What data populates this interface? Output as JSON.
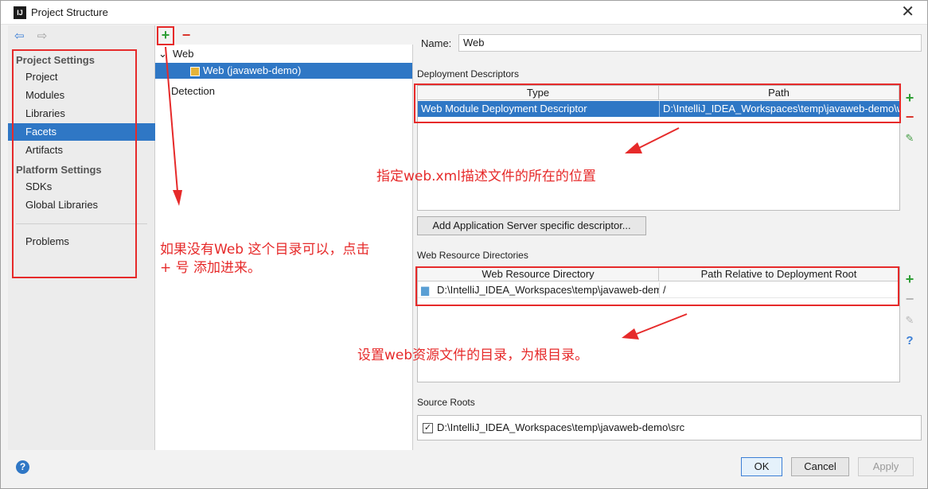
{
  "window": {
    "title": "Project Structure",
    "icon_label": "IJ"
  },
  "sidebar": {
    "project_settings_header": "Project Settings",
    "platform_settings_header": "Platform Settings",
    "items": [
      {
        "label": "Project"
      },
      {
        "label": "Modules"
      },
      {
        "label": "Libraries"
      },
      {
        "label": "Facets"
      },
      {
        "label": "Artifacts"
      },
      {
        "label": "SDKs"
      },
      {
        "label": "Global Libraries"
      },
      {
        "label": "Problems"
      }
    ],
    "selected": "Facets"
  },
  "tree": {
    "add_symbol": "+",
    "remove_symbol": "−",
    "root": "Web",
    "child": "Web (javaweb-demo)",
    "detection": "Detection"
  },
  "facet": {
    "name_label": "Name:",
    "name_value": "Web",
    "deployment_descriptors_title": "Deployment Descriptors",
    "dd_columns": [
      "Type",
      "Path"
    ],
    "dd_row": {
      "type": "Web Module Deployment Descriptor",
      "path": "D:\\IntelliJ_IDEA_Workspaces\\temp\\javaweb-demo\\w"
    },
    "add_descriptor_button": "Add Application Server specific descriptor...",
    "web_resource_title": "Web Resource Directories",
    "wr_columns": [
      "Web Resource Directory",
      "Path Relative to Deployment Root"
    ],
    "wr_row": {
      "dir": "D:\\IntelliJ_IDEA_Workspaces\\temp\\javaweb-demo\\web",
      "path": "/"
    },
    "source_roots_title": "Source Roots",
    "source_root": "D:\\IntelliJ_IDEA_Workspaces\\temp\\javaweb-demo\\src"
  },
  "buttons": {
    "ok": "OK",
    "cancel": "Cancel",
    "apply": "Apply"
  },
  "annotations": {
    "descriptor_note": "指定web.xml描述文件的所在的位置",
    "add_note_line1": "如果没有Web 这个目录可以，点击",
    "add_note_line2": "+ 号  添加进来。",
    "resource_note": "设置web资源文件的目录，为根目录。"
  },
  "colors": {
    "selection": "#2f77c5",
    "annotation": "#e62a2a",
    "add_green": "#2f9e36",
    "remove_red": "#d9342b"
  }
}
